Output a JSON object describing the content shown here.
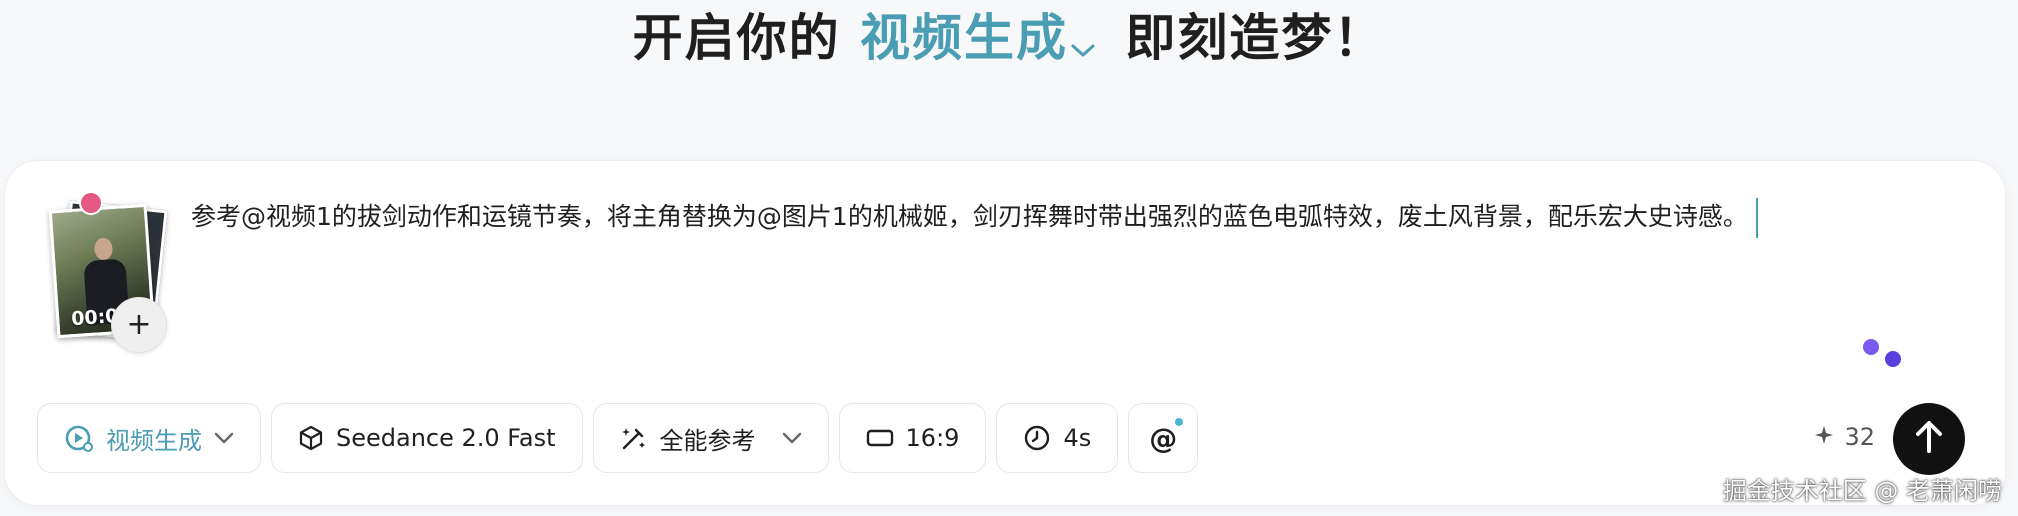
{
  "headline": {
    "prefix": "开启你的",
    "mode": "视频生成",
    "suffix": "即刻造梦！"
  },
  "reference": {
    "duration": "00:0",
    "add_label": "+"
  },
  "prompt_text": "参考@视频1的拔剑动作和运镜节奏，将主角替换为@图片1的机械姬，剑刃挥舞时带出强烈的蓝色电弧特效，废土风背景，配乐宏大史诗感。",
  "toolbar": {
    "mode_label": "视频生成",
    "model_label": "Seedance 2.0 Fast",
    "reference_label": "全能参考",
    "ratio_label": "16:9",
    "duration_label": "4s",
    "mention_label": "@"
  },
  "credits": "32",
  "watermark": "掘金技术社区 @ 老萧闲唠",
  "colors": {
    "accent": "#4a9db3",
    "submit": "#111111",
    "dot_purple": "#7a5af0"
  }
}
